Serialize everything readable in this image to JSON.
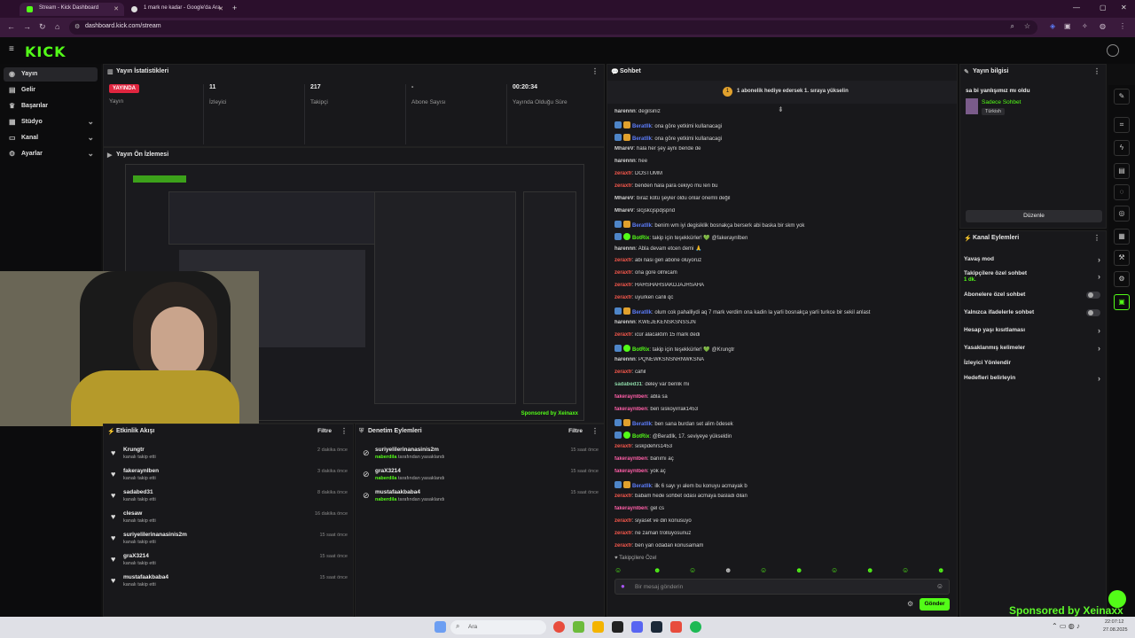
{
  "browser": {
    "tabs": [
      {
        "label": "Stream - Kick Dashboard",
        "active": true
      },
      {
        "label": "1 mark ne kadar - Google'da Ara",
        "active": false
      }
    ],
    "new_tab_symbol": "+",
    "url": "dashboard.kick.com/stream"
  },
  "header": {
    "logo": "KICK"
  },
  "sidebar": {
    "items": [
      {
        "label": "Yayın",
        "icon": "broadcast-icon",
        "active": true,
        "expandable": false
      },
      {
        "label": "Gelir",
        "icon": "money-icon",
        "active": false,
        "expandable": false
      },
      {
        "label": "Başarılar",
        "icon": "trophy-icon",
        "active": false,
        "expandable": false
      },
      {
        "label": "Stüdyo",
        "icon": "studio-icon",
        "active": false,
        "expandable": true
      },
      {
        "label": "Kanal",
        "icon": "channel-icon",
        "active": false,
        "expandable": true
      },
      {
        "label": "Ayarlar",
        "icon": "settings-icon",
        "active": false,
        "expandable": true
      }
    ]
  },
  "stats": {
    "title": "Yayın İstatistikleri",
    "items": [
      {
        "value": "YAYINDA",
        "label": "Yayın"
      },
      {
        "value": "11",
        "label": "İzleyici"
      },
      {
        "value": "217",
        "label": "Takipçi"
      },
      {
        "value": "-",
        "label": "Abone Sayısı"
      },
      {
        "value": "00:20:34",
        "label": "Yayında Olduğu Süre"
      }
    ]
  },
  "preview": {
    "title": "Yayın Ön İzlemesi",
    "sponsor_text": "Sponsored by Xeinaxx"
  },
  "activity": {
    "title": "Etkinlik Akışı",
    "filter": "Filtre",
    "items": [
      {
        "name": "Krungtr",
        "sub": "kanalı takip etti",
        "time": "2 dakika önce"
      },
      {
        "name": "fakeraynIben",
        "sub": "kanalı takip etti",
        "time": "3 dakika önce"
      },
      {
        "name": "sadabed31",
        "sub": "kanalı takip etti",
        "time": "8 dakika önce"
      },
      {
        "name": "clesaw",
        "sub": "kanalı takip etti",
        "time": "16 dakika önce"
      },
      {
        "name": "suriyelilerinanasinis2m",
        "sub": "kanalı takip etti",
        "time": "15 saat önce"
      },
      {
        "name": "graX3214",
        "sub": "kanalı takip etti",
        "time": "15 saat önce"
      },
      {
        "name": "mustafaakbaba4",
        "sub": "kanalı takip etti",
        "time": "15 saat önce"
      }
    ]
  },
  "moderation": {
    "title": "Denetim Eylemleri",
    "filter": "Filtre",
    "items": [
      {
        "name": "suriyelilerinanasinis2m",
        "by": "naberdila",
        "sub": "tarafından yasaklandı",
        "time": "15 saat önce"
      },
      {
        "name": "graX3214",
        "by": "naberdila",
        "sub": "tarafından yasaklandı",
        "time": "15 saat önce"
      },
      {
        "name": "mustafaakbaba4",
        "by": "naberdila",
        "sub": "tarafından yasaklandı",
        "time": "15 saat önce"
      }
    ]
  },
  "chat": {
    "title": "Sohbet",
    "gift_banner": "1 abonelik hediye edersek 1. sıraya yükselin",
    "messages": [
      {
        "user": "harennn",
        "color": "white",
        "badges": [],
        "text": "degilsiniz"
      },
      {
        "user": "Beratllk",
        "color": "blue",
        "badges": [
          "mod",
          "sub"
        ],
        "text": "ona göre yetkimi kullanacagi"
      },
      {
        "user": "Beratllk",
        "color": "blue",
        "badges": [
          "mod",
          "sub"
        ],
        "text": "ona göre yetkimi kullanacagi"
      },
      {
        "user": "MhareV",
        "color": "white",
        "badges": [],
        "text": "hala her şey aynı bende de"
      },
      {
        "user": "harennn",
        "color": "white",
        "badges": [],
        "text": "hee"
      },
      {
        "user": "zeraxfr",
        "color": "red",
        "badges": [],
        "text": "DOSTUMM"
      },
      {
        "user": "zeraxfr",
        "color": "red",
        "badges": [],
        "text": "benden hala para cekiyo mu len bu"
      },
      {
        "user": "MhareV",
        "color": "white",
        "badges": [],
        "text": "biraz kötü şeyler oldu onlar önemli değil"
      },
      {
        "user": "MhareV",
        "color": "white",
        "badges": [],
        "text": "slcjskcjspdjspnd"
      },
      {
        "user": "Beratllk",
        "color": "blue",
        "badges": [
          "mod",
          "sub"
        ],
        "text": "benim wm iyi degisiklik bosnakça berserk abi baska bir skm yok"
      },
      {
        "user": "BotRix",
        "color": "green",
        "badges": [
          "mod",
          "bot"
        ],
        "text": "takip için teşekkürler! 💚 @fakeraynIben"
      },
      {
        "user": "harennn",
        "color": "white",
        "badges": [],
        "text": "Abla devam etcen demi 🙏"
      },
      {
        "user": "zeraxfr",
        "color": "red",
        "badges": [],
        "text": "abi nasi geri abone oluyoruz"
      },
      {
        "user": "zeraxfr",
        "color": "red",
        "badges": [],
        "text": "ona gore olmicam"
      },
      {
        "user": "zeraxfr",
        "color": "red",
        "badges": [],
        "text": "HAHSHAHSIAKDJAJHSAHA"
      },
      {
        "user": "zeraxfr",
        "color": "red",
        "badges": [],
        "text": "uyurken canli qc"
      },
      {
        "user": "Beratllk",
        "color": "blue",
        "badges": [
          "mod",
          "sub"
        ],
        "text": "olum cok pahalliydi aq 7 mark verdim ona kadin la yarli bosnakça yarli turkce bir sekil anlast"
      },
      {
        "user": "harennn",
        "color": "white",
        "badges": [],
        "text": "KWEJEKENSKSNSSJN"
      },
      {
        "user": "zeraxfr",
        "color": "red",
        "badges": [],
        "text": "icür alacaktım 15 mark dedi"
      },
      {
        "user": "BotRix",
        "color": "green",
        "badges": [
          "mod",
          "bot"
        ],
        "text": "takip için teşekkürler! 💚 @Krungtr"
      },
      {
        "user": "harennn",
        "color": "white",
        "badges": [],
        "text": "PQNEWKSNSNRNWKSNA"
      },
      {
        "user": "zeraxfr",
        "color": "red",
        "badges": [],
        "text": "cahil"
      },
      {
        "user": "sadabed31",
        "color": "mint",
        "badges": [],
        "text": "deley var benlik mi"
      },
      {
        "user": "fakeraynIben",
        "color": "pink",
        "badges": [],
        "text": "abla sa"
      },
      {
        "user": "fakeraynIben",
        "color": "pink",
        "badges": [],
        "text": "ben siskoyırrak1453"
      },
      {
        "user": "Beratllk",
        "color": "blue",
        "badges": [
          "mod",
          "sub"
        ],
        "text": "ben sana burdan set alim ödesek"
      },
      {
        "user": "BotRix",
        "color": "green",
        "badges": [
          "mod",
          "bot"
        ],
        "text": "@Beratllk, 17. seviyeye yükseldin"
      },
      {
        "user": "zeraxfr",
        "color": "red",
        "badges": [],
        "text": "siskpdehrs1453"
      },
      {
        "user": "fakeraynIben",
        "color": "pink",
        "badges": [],
        "text": "banımı aç"
      },
      {
        "user": "fakeraynIben",
        "color": "pink",
        "badges": [],
        "text": "yok aç"
      },
      {
        "user": "Beratllk",
        "color": "blue",
        "badges": [
          "mod",
          "sub"
        ],
        "text": "ilk 6 sayı yı alem bu konuyu acmayak b"
      },
      {
        "user": "zeraxfr",
        "color": "red",
        "badges": [],
        "text": "babam hede sohbet odasi acmaya basladi dilan"
      },
      {
        "user": "fakeraynIben",
        "color": "pink",
        "badges": [],
        "text": "gel cs"
      },
      {
        "user": "zeraxfr",
        "color": "red",
        "badges": [],
        "text": "siyaset ve din konusuyo"
      },
      {
        "user": "zeraxfr",
        "color": "red",
        "badges": [],
        "text": "ne zaman trollüyosunuz"
      },
      {
        "user": "zeraxfr",
        "color": "red",
        "badges": [],
        "text": "ben yan odadan konusamam"
      }
    ],
    "followers_only": "Takipçilere Özel",
    "input_placeholder": "Bir mesaj gönderin",
    "send_label": "Gönder"
  },
  "stream_info": {
    "title": "Yayın bilgisi",
    "stream_title": "sa bi yanlışımız mı oldu",
    "category": "Sadece Sohbet",
    "tag": "Türkish",
    "edit_label": "Düzenle"
  },
  "channel_actions": {
    "title": "Kanal Eylemleri",
    "items": [
      {
        "label": "Yavaş mod",
        "sub": "",
        "control": "chevron"
      },
      {
        "label": "Takipçilere özel sohbet",
        "sub": "1 dk.",
        "control": "chevron"
      },
      {
        "label": "Abonelere özel sohbet",
        "sub": "",
        "control": "toggle"
      },
      {
        "label": "Yalnızca ifadelerle sohbet",
        "sub": "",
        "control": "toggle"
      },
      {
        "label": "Hesap yaşı kısıtlaması",
        "sub": "",
        "control": "chevron"
      },
      {
        "label": "Yasaklanmış kelimeler",
        "sub": "",
        "control": "chevron"
      },
      {
        "label": "İzleyici Yönlendir",
        "sub": "",
        "control": "none"
      },
      {
        "label": "Hedefleri belirleyin",
        "sub": "",
        "control": "chevron"
      }
    ]
  },
  "taskbar": {
    "search_label": "Ara",
    "time": "22:07:12",
    "date": "27.08.2025"
  },
  "overlay_sponsor": "Sponsored by Xeinaxx",
  "colors": {
    "accent": "#53fc18",
    "live": "#e0253f",
    "bg": "#0f0f10",
    "panel": "#18181b"
  }
}
